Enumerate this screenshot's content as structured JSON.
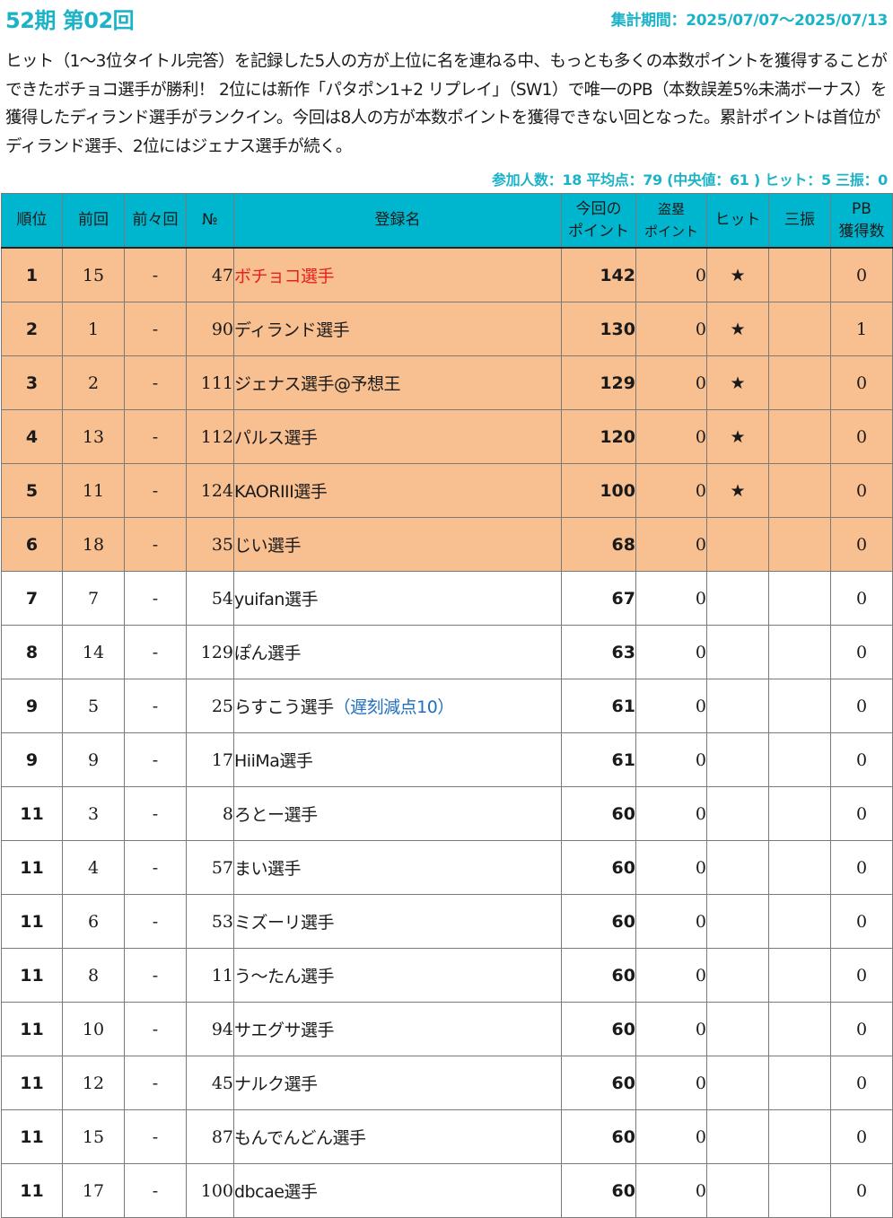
{
  "header": {
    "title": "52期 第02回",
    "period": "集計期間：2025/07/07〜2025/07/13"
  },
  "description": "ヒット（1〜3位タイトル完答）を記録した5人の方が上位に名を連ねる中、もっとも多くの本数ポイントを獲得することができたボチョコ選手が勝利！ 2位には新作「パタポン1+2 リプレイ」（SW1）で唯一のPB（本数誤差5%未満ボーナス）を獲得したディランド選手がランクイン。今回は8人の方が本数ポイントを獲得できない回となった。累計ポイントは首位がディランド選手、2位にはジェナス選手が続く。",
  "stats": "参加人数：18 平均点：79 (中央値：61 ) ヒット：5 三振：0",
  "columns": {
    "rank": "順位",
    "prev": "前回",
    "prev2": "前々回",
    "no": "№",
    "name": "登録名",
    "points_line1": "今回の",
    "points_line2": "ポイント",
    "steal_line1": "盗塁",
    "steal_line2": "ポイント",
    "hit": "ヒット",
    "strikeout": "三振",
    "pb_line1": "PB",
    "pb_line2": "獲得数"
  },
  "colors": {
    "accent": "#1cb3c8",
    "header_bg": "#00b5ce",
    "highlight_row": "#f8bf90",
    "winner_name": "#e8211d",
    "hit_star": "#e8110f",
    "penalty_note": "#1f6fbf"
  },
  "rows": [
    {
      "rank": "1",
      "prev": "15",
      "prev2": "-",
      "no": "47",
      "name": "ボチョコ選手",
      "note": "",
      "points": "142",
      "steal": "0",
      "hit": "★",
      "strikeout": "",
      "pb": "0",
      "highlight": true,
      "winner": true
    },
    {
      "rank": "2",
      "prev": "1",
      "prev2": "-",
      "no": "90",
      "name": "ディランド選手",
      "note": "",
      "points": "130",
      "steal": "0",
      "hit": "★",
      "strikeout": "",
      "pb": "1",
      "highlight": true,
      "winner": false
    },
    {
      "rank": "3",
      "prev": "2",
      "prev2": "-",
      "no": "111",
      "name": "ジェナス選手@予想王",
      "note": "",
      "points": "129",
      "steal": "0",
      "hit": "★",
      "strikeout": "",
      "pb": "0",
      "highlight": true,
      "winner": false
    },
    {
      "rank": "4",
      "prev": "13",
      "prev2": "-",
      "no": "112",
      "name": "パルス選手",
      "note": "",
      "points": "120",
      "steal": "0",
      "hit": "★",
      "strikeout": "",
      "pb": "0",
      "highlight": true,
      "winner": false
    },
    {
      "rank": "5",
      "prev": "11",
      "prev2": "-",
      "no": "124",
      "name": "KAORIII選手",
      "note": "",
      "points": "100",
      "steal": "0",
      "hit": "★",
      "strikeout": "",
      "pb": "0",
      "highlight": true,
      "winner": false
    },
    {
      "rank": "6",
      "prev": "18",
      "prev2": "-",
      "no": "35",
      "name": "じい選手",
      "note": "",
      "points": "68",
      "steal": "0",
      "hit": "",
      "strikeout": "",
      "pb": "0",
      "highlight": true,
      "winner": false
    },
    {
      "rank": "7",
      "prev": "7",
      "prev2": "-",
      "no": "54",
      "name": "yuifan選手",
      "note": "",
      "points": "67",
      "steal": "0",
      "hit": "",
      "strikeout": "",
      "pb": "0",
      "highlight": false,
      "winner": false
    },
    {
      "rank": "8",
      "prev": "14",
      "prev2": "-",
      "no": "129",
      "name": "ぽん選手",
      "note": "",
      "points": "63",
      "steal": "0",
      "hit": "",
      "strikeout": "",
      "pb": "0",
      "highlight": false,
      "winner": false
    },
    {
      "rank": "9",
      "prev": "5",
      "prev2": "-",
      "no": "25",
      "name": "らすこう選手",
      "note": "（遅刻減点10）",
      "points": "61",
      "steal": "0",
      "hit": "",
      "strikeout": "",
      "pb": "0",
      "highlight": false,
      "winner": false
    },
    {
      "rank": "9",
      "prev": "9",
      "prev2": "-",
      "no": "17",
      "name": "HiiMa選手",
      "note": "",
      "points": "61",
      "steal": "0",
      "hit": "",
      "strikeout": "",
      "pb": "0",
      "highlight": false,
      "winner": false
    },
    {
      "rank": "11",
      "prev": "3",
      "prev2": "-",
      "no": "8",
      "name": "ろとー選手",
      "note": "",
      "points": "60",
      "steal": "0",
      "hit": "",
      "strikeout": "",
      "pb": "0",
      "highlight": false,
      "winner": false
    },
    {
      "rank": "11",
      "prev": "4",
      "prev2": "-",
      "no": "57",
      "name": "まい選手",
      "note": "",
      "points": "60",
      "steal": "0",
      "hit": "",
      "strikeout": "",
      "pb": "0",
      "highlight": false,
      "winner": false
    },
    {
      "rank": "11",
      "prev": "6",
      "prev2": "-",
      "no": "53",
      "name": "ミズーリ選手",
      "note": "",
      "points": "60",
      "steal": "0",
      "hit": "",
      "strikeout": "",
      "pb": "0",
      "highlight": false,
      "winner": false
    },
    {
      "rank": "11",
      "prev": "8",
      "prev2": "-",
      "no": "11",
      "name": "う〜たん選手",
      "note": "",
      "points": "60",
      "steal": "0",
      "hit": "",
      "strikeout": "",
      "pb": "0",
      "highlight": false,
      "winner": false
    },
    {
      "rank": "11",
      "prev": "10",
      "prev2": "-",
      "no": "94",
      "name": "サエグサ選手",
      "note": "",
      "points": "60",
      "steal": "0",
      "hit": "",
      "strikeout": "",
      "pb": "0",
      "highlight": false,
      "winner": false
    },
    {
      "rank": "11",
      "prev": "12",
      "prev2": "-",
      "no": "45",
      "name": "ナルク選手",
      "note": "",
      "points": "60",
      "steal": "0",
      "hit": "",
      "strikeout": "",
      "pb": "0",
      "highlight": false,
      "winner": false
    },
    {
      "rank": "11",
      "prev": "15",
      "prev2": "-",
      "no": "87",
      "name": "もんでんどん選手",
      "note": "",
      "points": "60",
      "steal": "0",
      "hit": "",
      "strikeout": "",
      "pb": "0",
      "highlight": false,
      "winner": false
    },
    {
      "rank": "11",
      "prev": "17",
      "prev2": "-",
      "no": "100",
      "name": "dbcae選手",
      "note": "",
      "points": "60",
      "steal": "0",
      "hit": "",
      "strikeout": "",
      "pb": "0",
      "highlight": false,
      "winner": false
    }
  ]
}
